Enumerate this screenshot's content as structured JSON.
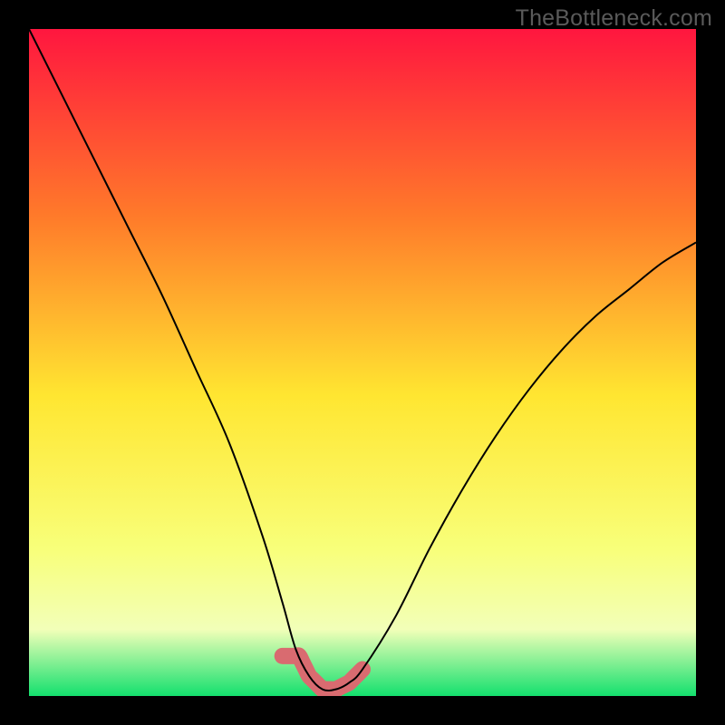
{
  "watermark": "TheBottleneck.com",
  "colors": {
    "bg": "#000000",
    "grad_top": "#ff163f",
    "grad_mid_upper": "#ff7a2a",
    "grad_mid": "#ffe631",
    "grad_mid_lower": "#f8ff7a",
    "grad_band": "#f2ffb8",
    "grad_bottom": "#13e06e",
    "curve": "#000000",
    "accent": "#d96b70"
  },
  "chart_data": {
    "type": "line",
    "title": "",
    "xlabel": "",
    "ylabel": "",
    "xlim": [
      0,
      100
    ],
    "ylim": [
      0,
      100
    ],
    "series": [
      {
        "name": "bottleneck-curve",
        "x": [
          0,
          5,
          10,
          15,
          20,
          25,
          30,
          35,
          38,
          40,
          42,
          44,
          46,
          48,
          50,
          55,
          60,
          65,
          70,
          75,
          80,
          85,
          90,
          95,
          100
        ],
        "values": [
          100,
          90,
          80,
          70,
          60,
          49,
          38,
          24,
          14,
          7,
          3,
          1,
          1,
          2,
          4,
          12,
          22,
          31,
          39,
          46,
          52,
          57,
          61,
          65,
          68
        ]
      }
    ],
    "accent_region": {
      "name": "optimal-zone",
      "x_range": [
        38,
        50
      ],
      "y_max": 6
    }
  }
}
